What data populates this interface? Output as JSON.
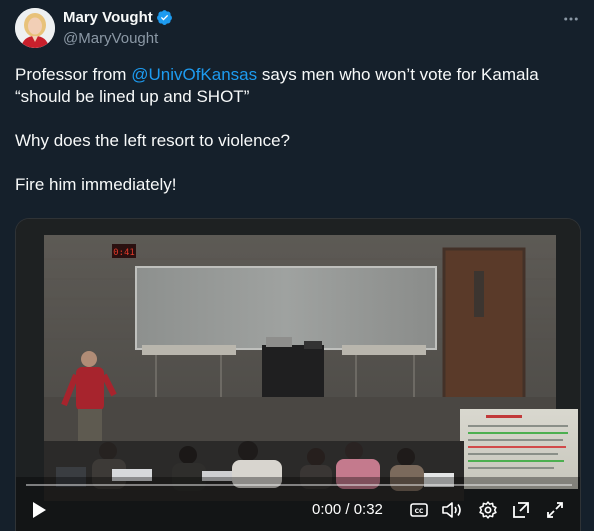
{
  "author": {
    "name": "Mary Vought",
    "handle": "@MaryVought",
    "verified": true
  },
  "tweet": {
    "line1_before": "Professor from ",
    "line1_mention": "@UnivOfKansas",
    "line1_after": " says men who won’t vote for Kamala",
    "line2": "“should be lined up and SHOT”",
    "line3": "Why does the left resort to violence?",
    "line4": "Fire him immediately!"
  },
  "video": {
    "time_display": "0:00 / 0:32",
    "progress": 0.0,
    "clock_readout": "0:41",
    "icons": [
      "play-icon",
      "captions-icon",
      "volume-icon",
      "settings-icon",
      "popout-icon",
      "fullscreen-icon"
    ]
  },
  "colors": {
    "background": "#15202b",
    "accent": "#1d9bf0",
    "secondary_text": "#8b98a5"
  }
}
